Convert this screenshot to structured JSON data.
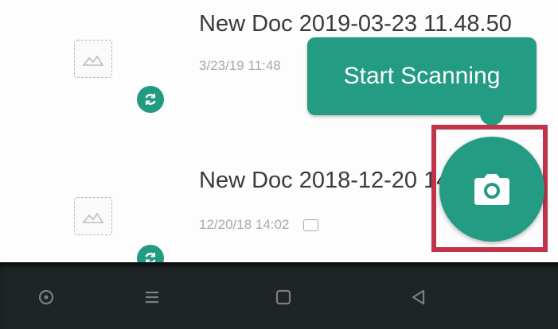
{
  "documents": [
    {
      "title": "New Doc 2019-03-23 11.48.50",
      "meta": "3/23/19 11:48"
    },
    {
      "title": "New Doc 2018-12-20 14.02",
      "meta": "12/20/18 14:02"
    }
  ],
  "tooltip": {
    "text": "Start Scanning"
  },
  "colors": {
    "accent": "#249b83",
    "highlight": "#c2334a",
    "navbar": "#1f2426"
  },
  "icons": {
    "thumbnail": "image-placeholder-icon",
    "sync": "sync-icon",
    "meta": "page-icon",
    "fab": "camera-icon",
    "nav": [
      "circle-icon",
      "menu-icon",
      "home-square-icon",
      "back-triangle-icon"
    ]
  }
}
